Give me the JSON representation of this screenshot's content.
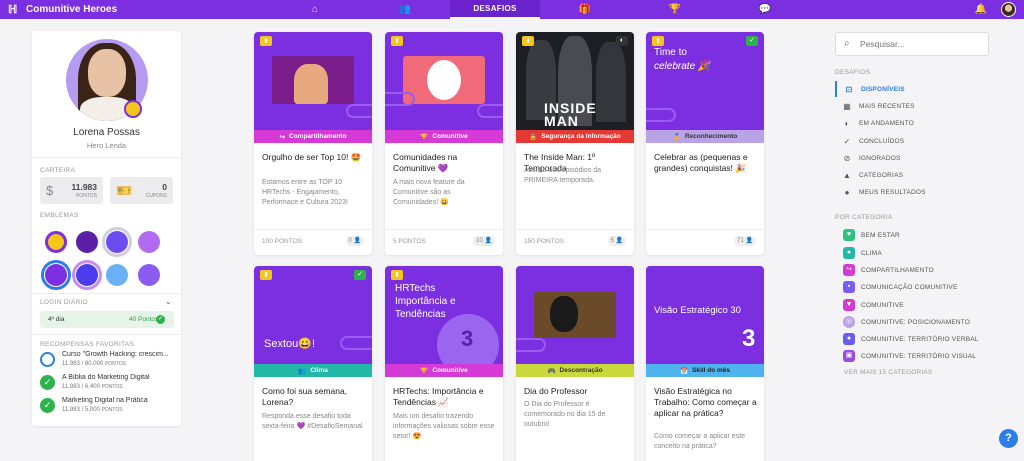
{
  "app": {
    "name": "Comunitive Heroes"
  },
  "nav": {
    "items": [
      {
        "icon": "home-icon",
        "label": ""
      },
      {
        "icon": "people-icon",
        "label": ""
      },
      {
        "icon": "flag-icon",
        "label": "DESAFIOS",
        "active": true
      },
      {
        "icon": "gift-icon",
        "label": ""
      },
      {
        "icon": "trophy-icon",
        "label": ""
      },
      {
        "icon": "chat-icon",
        "label": ""
      }
    ]
  },
  "profile": {
    "name": "Lorena Possas",
    "title": "Hero Lenda",
    "wallet_label": "CARTEIRA",
    "points_value": "11.983",
    "points_label": "PONTOS",
    "coupons_value": "0",
    "coupons_label": "CUPONS",
    "emblems_label": "EMBLEMAS",
    "login_label": "LOGIN DIÁRIO",
    "login_day": "4º dia",
    "login_points": "40 Pontos",
    "favorites_label": "RECOMPENSAS FAVORITAS",
    "favorites": [
      {
        "title": "Curso \"Growth Hacking: crescim...",
        "points": "11.983 / 80.000",
        "unit": "PONTOS",
        "complete": false
      },
      {
        "title": "A Bíblia do Marketing Digital",
        "points": "11.983 / 6.400",
        "unit": "PONTOS",
        "complete": true
      },
      {
        "title": "Marketing Digital na Prática",
        "points": "11.983 / 5.000",
        "unit": "PONTOS",
        "complete": true
      }
    ]
  },
  "cards": [
    {
      "category": "Compartilhamento",
      "cat_color": "#d63ad6",
      "title": "Orgulho de ser Top 10! 🤩",
      "desc": "Estamos entre as TOP 10 HRTechs - Engajamento, Performace e Cultura 2023!",
      "points": "100 PONTOS",
      "count": "0"
    },
    {
      "category": "Comunitive",
      "cat_color": "#d63ad6",
      "title": "Comunidades na Comunitive 💜",
      "desc": "A mais nova feature da Comunitive são as Comunidades! 😀",
      "points": "5 PONTOS",
      "count": "10"
    },
    {
      "category": "Segurança da Informação",
      "cat_color": "#e53935",
      "title": "The Inside Man: 1º Temporada",
      "desc": "Assista aos episódios da PRIMEIRA temporada.",
      "points": "150 PONTOS",
      "count": "5",
      "banner_text": "INSIDE MAN"
    },
    {
      "category": "Reconhecimento",
      "cat_color": "#b9a3e6",
      "title": "Celebrar as (pequenas e grandes) conquistas! 🎉",
      "desc": "",
      "points": "",
      "count": "71",
      "banner_line1": "Time to",
      "banner_line2": "celebrate 🎉"
    },
    {
      "category": "Clima",
      "cat_color": "#22b8a8",
      "title": "Como foi sua semana, Lorena?",
      "desc": "Responda esse desafio toda sexta-feira 💜 #DesafioSemanal",
      "banner_text": "Sextou😀!"
    },
    {
      "category": "Comunitive",
      "cat_color": "#d63ad6",
      "title": "HRTechs: Importância e Tendências 📈",
      "desc": "Mais um desafio trazendo informações valiosas sobre esse setor! 😍",
      "banner_text": "HRTechs Importância e Tendências",
      "banner_number": "3"
    },
    {
      "category": "Descontração",
      "cat_color": "#c9d83a",
      "title": "Dia do Professor",
      "desc": "O Dia do Professor é comemorado no dia 15 de outubro!"
    },
    {
      "category": "Skill do mês",
      "cat_color": "#4fb3f0",
      "title": "Visão Estratégica no Trabalho: Como começar a aplicar na prática?",
      "desc": "Como começar a aplicar este conceito na prática?",
      "banner_text": "Visão Estratégico 30",
      "banner_number": "3"
    }
  ],
  "right": {
    "search_placeholder": "Pesquisar...",
    "challenges_label": "DESAFIOS",
    "filters": [
      {
        "label": "DISPONÍVEIS",
        "icon": "gamepad-icon",
        "active": true
      },
      {
        "label": "MAIS RECENTES",
        "icon": "calendar-icon"
      },
      {
        "label": "EM ANDAMENTO",
        "icon": "half-circle-icon"
      },
      {
        "label": "CONCLUÍDOS",
        "icon": "check-icon"
      },
      {
        "label": "IGNORADOS",
        "icon": "eye-off-icon"
      },
      {
        "label": "CATEGORIAS",
        "icon": "shapes-icon"
      },
      {
        "label": "MEUS RESULTADOS",
        "icon": "user-icon"
      }
    ],
    "by_category_label": "POR CATEGORIA",
    "categories": [
      {
        "label": "BEM ESTAR",
        "color": "#2ec27e"
      },
      {
        "label": "CLIMA",
        "color": "#22b8a8"
      },
      {
        "label": "COMPARTILHAMENTO",
        "color": "#d63ad6"
      },
      {
        "label": "COMUNICAÇÃO COMUNITIVE",
        "color": "#7b5cf0"
      },
      {
        "label": "COMUNITIVE",
        "color": "#d63ad6"
      },
      {
        "label": "COMUNITIVE: POSICIONAMENTO",
        "color": "#b9a3e6"
      },
      {
        "label": "COMUNITIVE: TERRITÓRIO VERBAL",
        "color": "#6a5cf0"
      },
      {
        "label": "COMUNITIVE: TERRITÓRIO VISUAL",
        "color": "#9a4ce0"
      }
    ],
    "more_label": "VER MAIS 15 CATEGORIAS"
  }
}
